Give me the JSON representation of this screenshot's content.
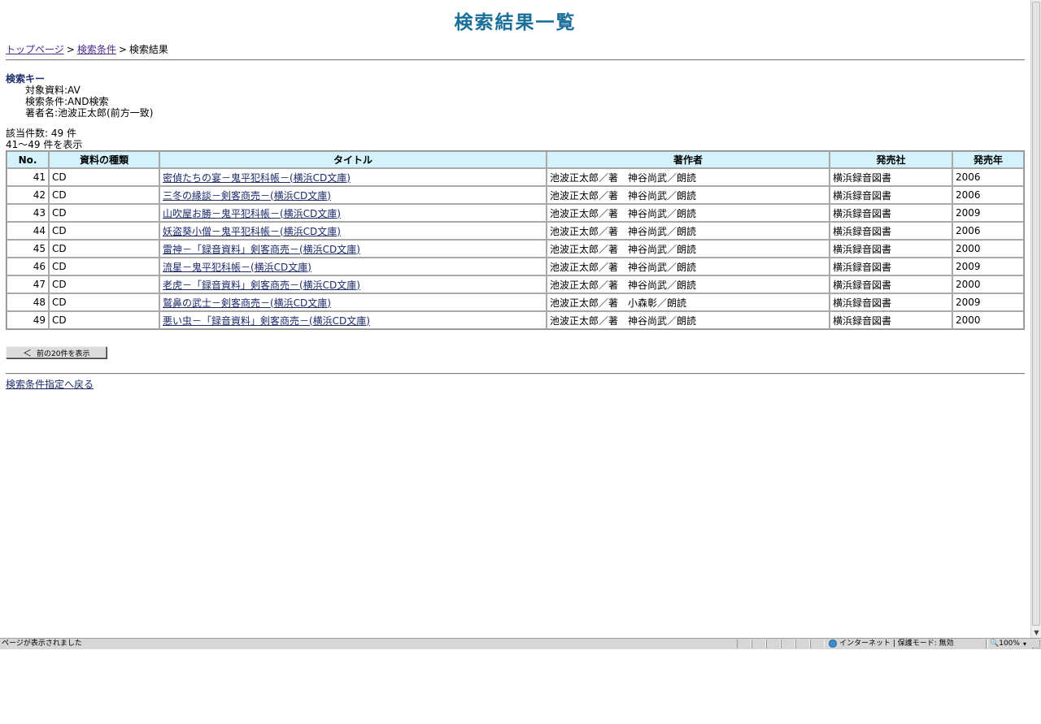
{
  "page": {
    "title": "検索結果一覧"
  },
  "breadcrumb": {
    "top": "トップページ",
    "sep1": ">",
    "conditions": "検索条件",
    "sep2": ">",
    "current": "検索結果"
  },
  "search_key": {
    "heading": "検索キー",
    "material": "対象資料:AV",
    "condition": "検索条件:AND検索",
    "author": "著者名:池波正太郎(前方一致)"
  },
  "result_info": {
    "hits": "該当件数: 49 件",
    "range": "41～49 件を表示"
  },
  "table": {
    "headers": {
      "no": "No.",
      "type": "資料の種類",
      "title": "タイトル",
      "author": "著作者",
      "publisher": "発売社",
      "year": "発売年"
    },
    "rows": [
      {
        "no": "41",
        "type": "CD",
        "title": "密偵たちの宴－鬼平犯科帳－(横浜CD文庫)",
        "author": "池波正太郎／著　神谷尚武／朗読",
        "publisher": "横浜録音図書",
        "year": "2006"
      },
      {
        "no": "42",
        "type": "CD",
        "title": "三冬の縁談－剣客商売－(横浜CD文庫)",
        "author": "池波正太郎／著　神谷尚武／朗読",
        "publisher": "横浜録音図書",
        "year": "2006"
      },
      {
        "no": "43",
        "type": "CD",
        "title": "山吹屋お勝－鬼平犯科帳－(横浜CD文庫)",
        "author": "池波正太郎／著　神谷尚武／朗読",
        "publisher": "横浜録音図書",
        "year": "2009"
      },
      {
        "no": "44",
        "type": "CD",
        "title": "妖盗葵小僧－鬼平犯科帳－(横浜CD文庫)",
        "author": "池波正太郎／著　神谷尚武／朗読",
        "publisher": "横浜録音図書",
        "year": "2006"
      },
      {
        "no": "45",
        "type": "CD",
        "title": "雷神－「録音資料」剣客商売－(横浜CD文庫)",
        "author": "池波正太郎／著　神谷尚武／朗読",
        "publisher": "横浜録音図書",
        "year": "2000"
      },
      {
        "no": "46",
        "type": "CD",
        "title": "流星－鬼平犯科帳－(横浜CD文庫)",
        "author": "池波正太郎／著　神谷尚武／朗読",
        "publisher": "横浜録音図書",
        "year": "2009"
      },
      {
        "no": "47",
        "type": "CD",
        "title": "老虎－「録音資料」剣客商売－(横浜CD文庫)",
        "author": "池波正太郎／著　神谷尚武／朗読",
        "publisher": "横浜録音図書",
        "year": "2000"
      },
      {
        "no": "48",
        "type": "CD",
        "title": "鷲鼻の武士－剣客商売－(横浜CD文庫)",
        "author": "池波正太郎／著　小森彰／朗読",
        "publisher": "横浜録音図書",
        "year": "2009"
      },
      {
        "no": "49",
        "type": "CD",
        "title": "悪い虫－「録音資料」剣客商売－(横浜CD文庫)",
        "author": "池波正太郎／著　神谷尚武／朗読",
        "publisher": "横浜録音図書",
        "year": "2000"
      }
    ]
  },
  "prev_button": {
    "arrow": "＜",
    "label": "前の20件を表示"
  },
  "back_link": "検索条件指定へ戻る",
  "statusbar": {
    "message": "ページが表示されました",
    "zone": "インターネット | 保護モード: 無効",
    "zoom": "100%",
    "zoom_caret": "▾"
  },
  "colors": {
    "title": "#1a6e9a",
    "header_bg": "#d4f2fb",
    "link": "#1c2a6a"
  }
}
